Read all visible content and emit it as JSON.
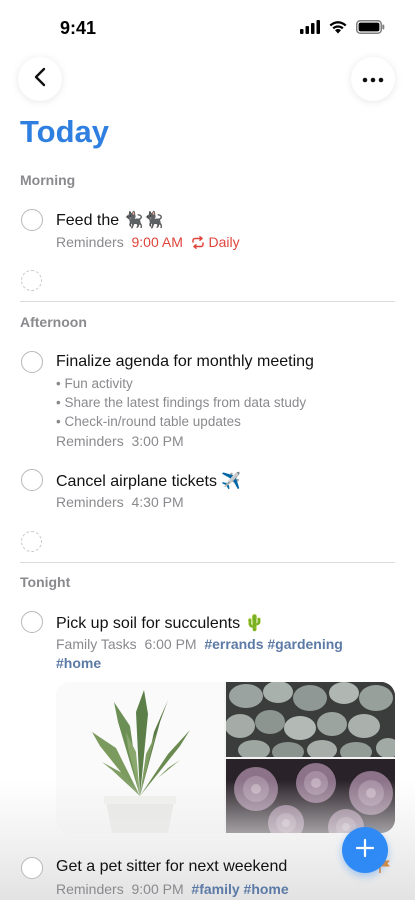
{
  "status_bar": {
    "time": "9:41",
    "icons": [
      "cellular-icon",
      "wifi-icon",
      "battery-icon"
    ]
  },
  "nav": {
    "back_icon": "chevron-left-icon",
    "more_icon": "ellipsis-icon"
  },
  "page": {
    "title": "Today",
    "title_color": "#2f7fe0"
  },
  "sections": {
    "morning": {
      "header": "Morning",
      "tasks": [
        {
          "title": "Feed the 🐈‍⬛🐈‍⬛",
          "list": "Reminders",
          "time": "9:00 AM",
          "repeat": "Daily",
          "repeat_icon": "repeat-icon"
        }
      ]
    },
    "afternoon": {
      "header": "Afternoon",
      "tasks": [
        {
          "title": "Finalize agenda for monthly meeting",
          "notes": [
            "• Fun activity",
            "• Share the latest findings from data study",
            "• Check-in/round table updates"
          ],
          "list": "Reminders",
          "time": "3:00 PM"
        },
        {
          "title": "Cancel airplane tickets ✈️",
          "list": "Reminders",
          "time": "4:30 PM"
        }
      ]
    },
    "tonight": {
      "header": "Tonight",
      "tasks": [
        {
          "title": "Pick up soil for succulents 🌵",
          "list": "Family Tasks",
          "time": "6:00 PM",
          "tags_line1": "#errands #gardening",
          "tags_line2": "#home",
          "photos": [
            "aloe-plant-photo",
            "pebble-succulents-photo",
            "purple-succulents-photo"
          ]
        },
        {
          "title": "Get a pet sitter for next weekend",
          "list": "Reminders",
          "time": "9:00 PM",
          "tags": "#family #home",
          "flag_icon": "flag-icon"
        }
      ]
    }
  },
  "colors": {
    "accent": "#2f8af5",
    "alert": "#e0453c",
    "tag": "#5c7aa6",
    "flag": "#e88a2c"
  },
  "fab": {
    "icon": "plus-icon"
  }
}
